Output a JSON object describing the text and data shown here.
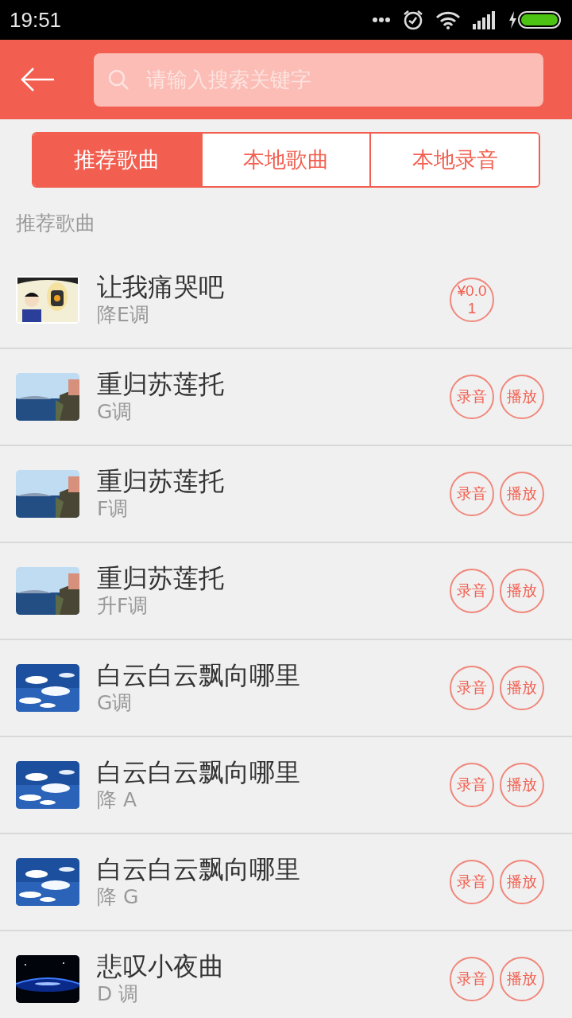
{
  "status_bar": {
    "time": "19:51"
  },
  "search": {
    "placeholder": "请输入搜索关键字"
  },
  "tabs": [
    {
      "label": "推荐歌曲",
      "selected": true
    },
    {
      "label": "本地歌曲",
      "selected": false
    },
    {
      "label": "本地录音",
      "selected": false
    }
  ],
  "section_title": "推荐歌曲",
  "songs": [
    {
      "title": "让我痛哭吧",
      "key": "降E调",
      "actions": [
        {
          "kind": "price",
          "label": "¥0.01"
        }
      ]
    },
    {
      "title": "重归苏莲托",
      "key": "G调",
      "actions": [
        {
          "kind": "button",
          "label": "录音"
        },
        {
          "kind": "button",
          "label": "播放"
        }
      ]
    },
    {
      "title": "重归苏莲托",
      "key": "F调",
      "actions": [
        {
          "kind": "button",
          "label": "录音"
        },
        {
          "kind": "button",
          "label": "播放"
        }
      ]
    },
    {
      "title": "重归苏莲托",
      "key": "升F调",
      "actions": [
        {
          "kind": "button",
          "label": "录音"
        },
        {
          "kind": "button",
          "label": "播放"
        }
      ]
    },
    {
      "title": "白云白云飘向哪里",
      "key": "G调",
      "actions": [
        {
          "kind": "button",
          "label": "录音"
        },
        {
          "kind": "button",
          "label": "播放"
        }
      ]
    },
    {
      "title": "白云白云飘向哪里",
      "key": "降 A",
      "actions": [
        {
          "kind": "button",
          "label": "录音"
        },
        {
          "kind": "button",
          "label": "播放"
        }
      ]
    },
    {
      "title": "白云白云飘向哪里",
      "key": "降 G",
      "actions": [
        {
          "kind": "button",
          "label": "录音"
        },
        {
          "kind": "button",
          "label": "播放"
        }
      ]
    },
    {
      "title": "悲叹小夜曲",
      "key": "D 调",
      "actions": [
        {
          "kind": "button",
          "label": "录音"
        },
        {
          "kind": "button",
          "label": "播放"
        }
      ]
    }
  ]
}
